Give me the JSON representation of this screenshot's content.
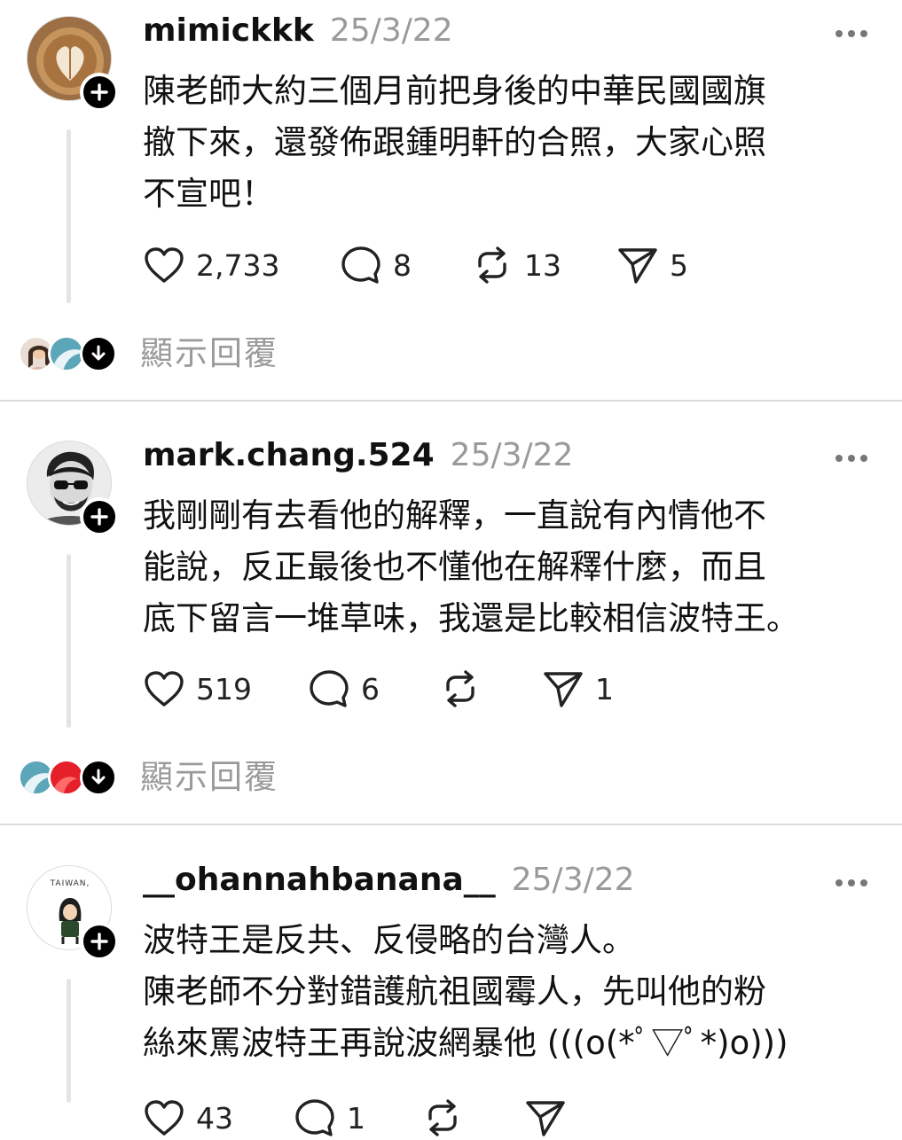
{
  "posts": [
    {
      "username": "mimickkk",
      "date": "25/3/22",
      "lines": [
        "陳老師大約三個月前把身後的中華民國國旗",
        "撤下來，還發佈跟鍾明軒的合照，大家心照",
        "不宣吧！"
      ],
      "likes": "2,733",
      "comments": "8",
      "reposts": "13",
      "shares": "5",
      "show_replies": "顯示回覆"
    },
    {
      "username": "mark.chang.524",
      "date": "25/3/22",
      "lines": [
        "我剛剛有去看他的解釋，一直說有內情他不",
        "能說，反正最後也不懂他在解釋什麼，而且",
        "底下留言一堆草味，我還是比較相信波特王。"
      ],
      "likes": "519",
      "comments": "6",
      "reposts": "",
      "shares": "1",
      "show_replies": "顯示回覆"
    },
    {
      "username": "__ohannahbanana__",
      "date": "25/3/22",
      "lines": [
        "波特王是反共、反侵略的台灣人。",
        "陳老師不分對錯護航祖國霉人，先叫他的粉",
        "絲來罵波特王再說波網暴他 (((o(*ﾟ▽ﾟ*)o)))"
      ],
      "avatar_text": "TAIWAN,",
      "likes": "43",
      "comments": "1",
      "reposts": "",
      "shares": ""
    }
  ],
  "icons": {
    "like": "heart-icon",
    "comment": "comment-bubble-icon",
    "repost": "repost-icon",
    "share": "send-icon",
    "more": "more-dots-icon",
    "follow": "plus-icon",
    "expand": "arrow-down-icon"
  },
  "colors": {
    "text": "#111111",
    "muted": "#9a9a9a",
    "thread_line": "#e4e4e4",
    "divider": "#dcdcdc"
  }
}
